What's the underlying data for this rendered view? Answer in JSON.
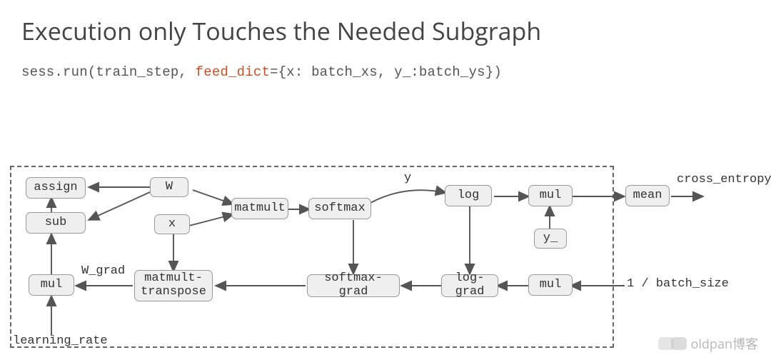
{
  "title": "Execution only Touches the Needed Subgraph",
  "code": {
    "prefix": "sess.run(train_step, ",
    "kw": "feed_dict",
    "suffix": "={x: batch_xs, y_:batch_ys})"
  },
  "nodes": {
    "assign": "assign",
    "sub": "sub",
    "mul1": "mul",
    "W": "W",
    "x": "x",
    "matmult": "matmult",
    "matmult_t": "matmult-\ntranspose",
    "softmax": "softmax",
    "softmax_grad": "softmax-grad",
    "log": "log",
    "log_grad": "log-grad",
    "mul2": "mul",
    "mul3": "mul",
    "y_": "y_",
    "mean": "mean"
  },
  "labels": {
    "W_grad": "W_grad",
    "learning_rate": "learning_rate",
    "y": "y",
    "cross_entropy": "cross_entropy",
    "batch": "1 / batch_size"
  },
  "watermark": "oldpan博客"
}
